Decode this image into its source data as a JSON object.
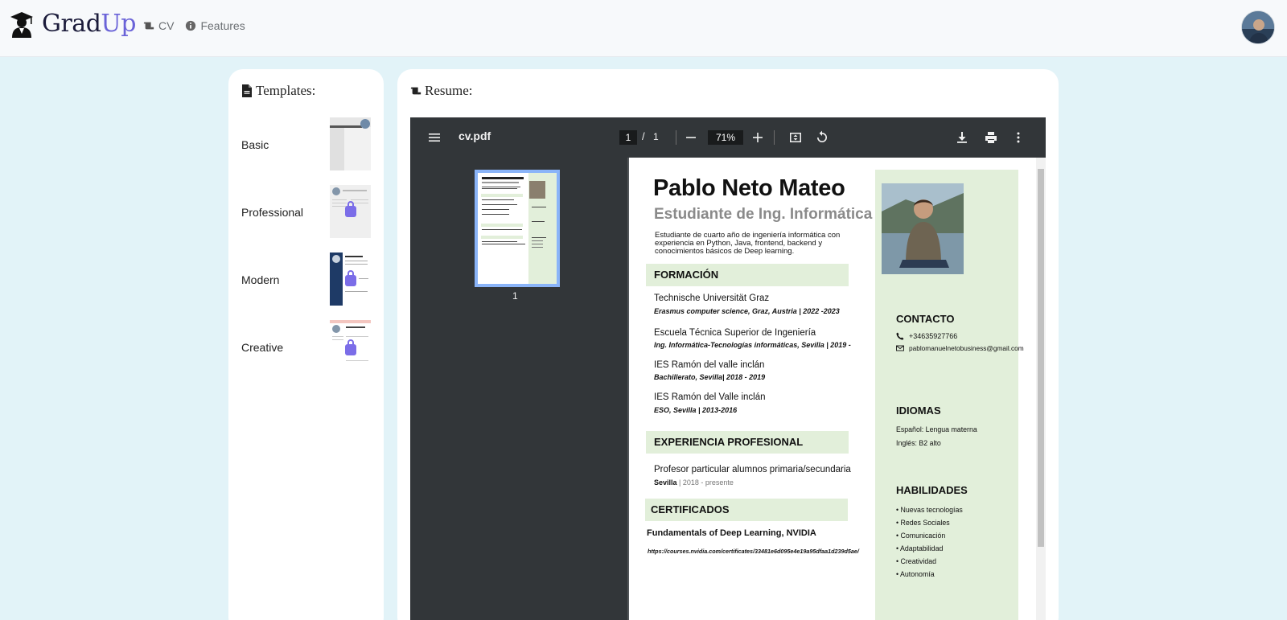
{
  "brand": {
    "name_primary": "Grad",
    "name_accent": "Up",
    "logo_icon": "graduate-icon",
    "accent_color": "#6a63d8"
  },
  "nav": {
    "links": [
      {
        "label": "CV",
        "icon": "scroll-icon"
      },
      {
        "label": "Features",
        "icon": "info-circle-icon"
      }
    ]
  },
  "templates": {
    "title": "Templates:",
    "items": [
      {
        "label": "Basic"
      },
      {
        "label": "Professional"
      },
      {
        "label": "Modern"
      },
      {
        "label": "Creative"
      }
    ]
  },
  "resume": {
    "title": "Resume:",
    "viewer": {
      "file_name": "cv.pdf",
      "page_current": "1",
      "page_separator": "/",
      "page_total": "1",
      "zoom": "71%",
      "thumbnail_number": "1"
    },
    "document": {
      "name": "Pablo Neto Mateo",
      "subtitle": "Estudiante de Ing. Informática",
      "summary": "Estudiante de cuarto año de ingeniería informática con experiencia en Python, Java, frontend, backend y conocimientos básicos de Deep learning.",
      "sections": {
        "formacion": "FORMACIÓN",
        "experiencia": "EXPERIENCIA PROFESIONAL",
        "certificados": "CERTIFICADOS"
      },
      "education": [
        {
          "title": "Technische Universität Graz",
          "detail": "Erasmus computer science, Graz, Austria | 2022 -2023"
        },
        {
          "title": "Escuela Técnica Superior de Ingeniería",
          "detail": "Ing. Informática-Tecnologías informáticas, Sevilla | 2019 -"
        },
        {
          "title": "IES Ramón del valle inclán",
          "detail": "Bachillerato, Sevilla| 2018 - 2019"
        },
        {
          "title": "IES Ramón del Valle inclán",
          "detail": "ESO, Sevilla | 2013-2016"
        }
      ],
      "experience": [
        {
          "title": "Profesor particular alumnos primaria/secundaria",
          "place": "Sevilla",
          "period": " | 2018 - presente"
        }
      ],
      "certificates": [
        {
          "title": "Fundamentals of Deep Learning, NVIDIA",
          "url": "https://courses.nvidia.com/certificates/33481e6d095e4e19a95dfaa1d239d5ae/"
        }
      ],
      "sidebar": {
        "contact_heading": "CONTACTO",
        "phone": "+34635927766",
        "email": "pablomanuelnetobusiness@gmail.com",
        "languages_heading": "IDIOMAS",
        "languages": [
          "Español: Lengua materna",
          "Inglés: B2 alto"
        ],
        "skills_heading": "HABILIDADES",
        "skills": [
          "• Nuevas tecnologías",
          "• Redes Sociales",
          "• Comunicación",
          "• Adaptabilidad",
          "• Creatividad",
          "• Autonomía"
        ]
      }
    }
  }
}
